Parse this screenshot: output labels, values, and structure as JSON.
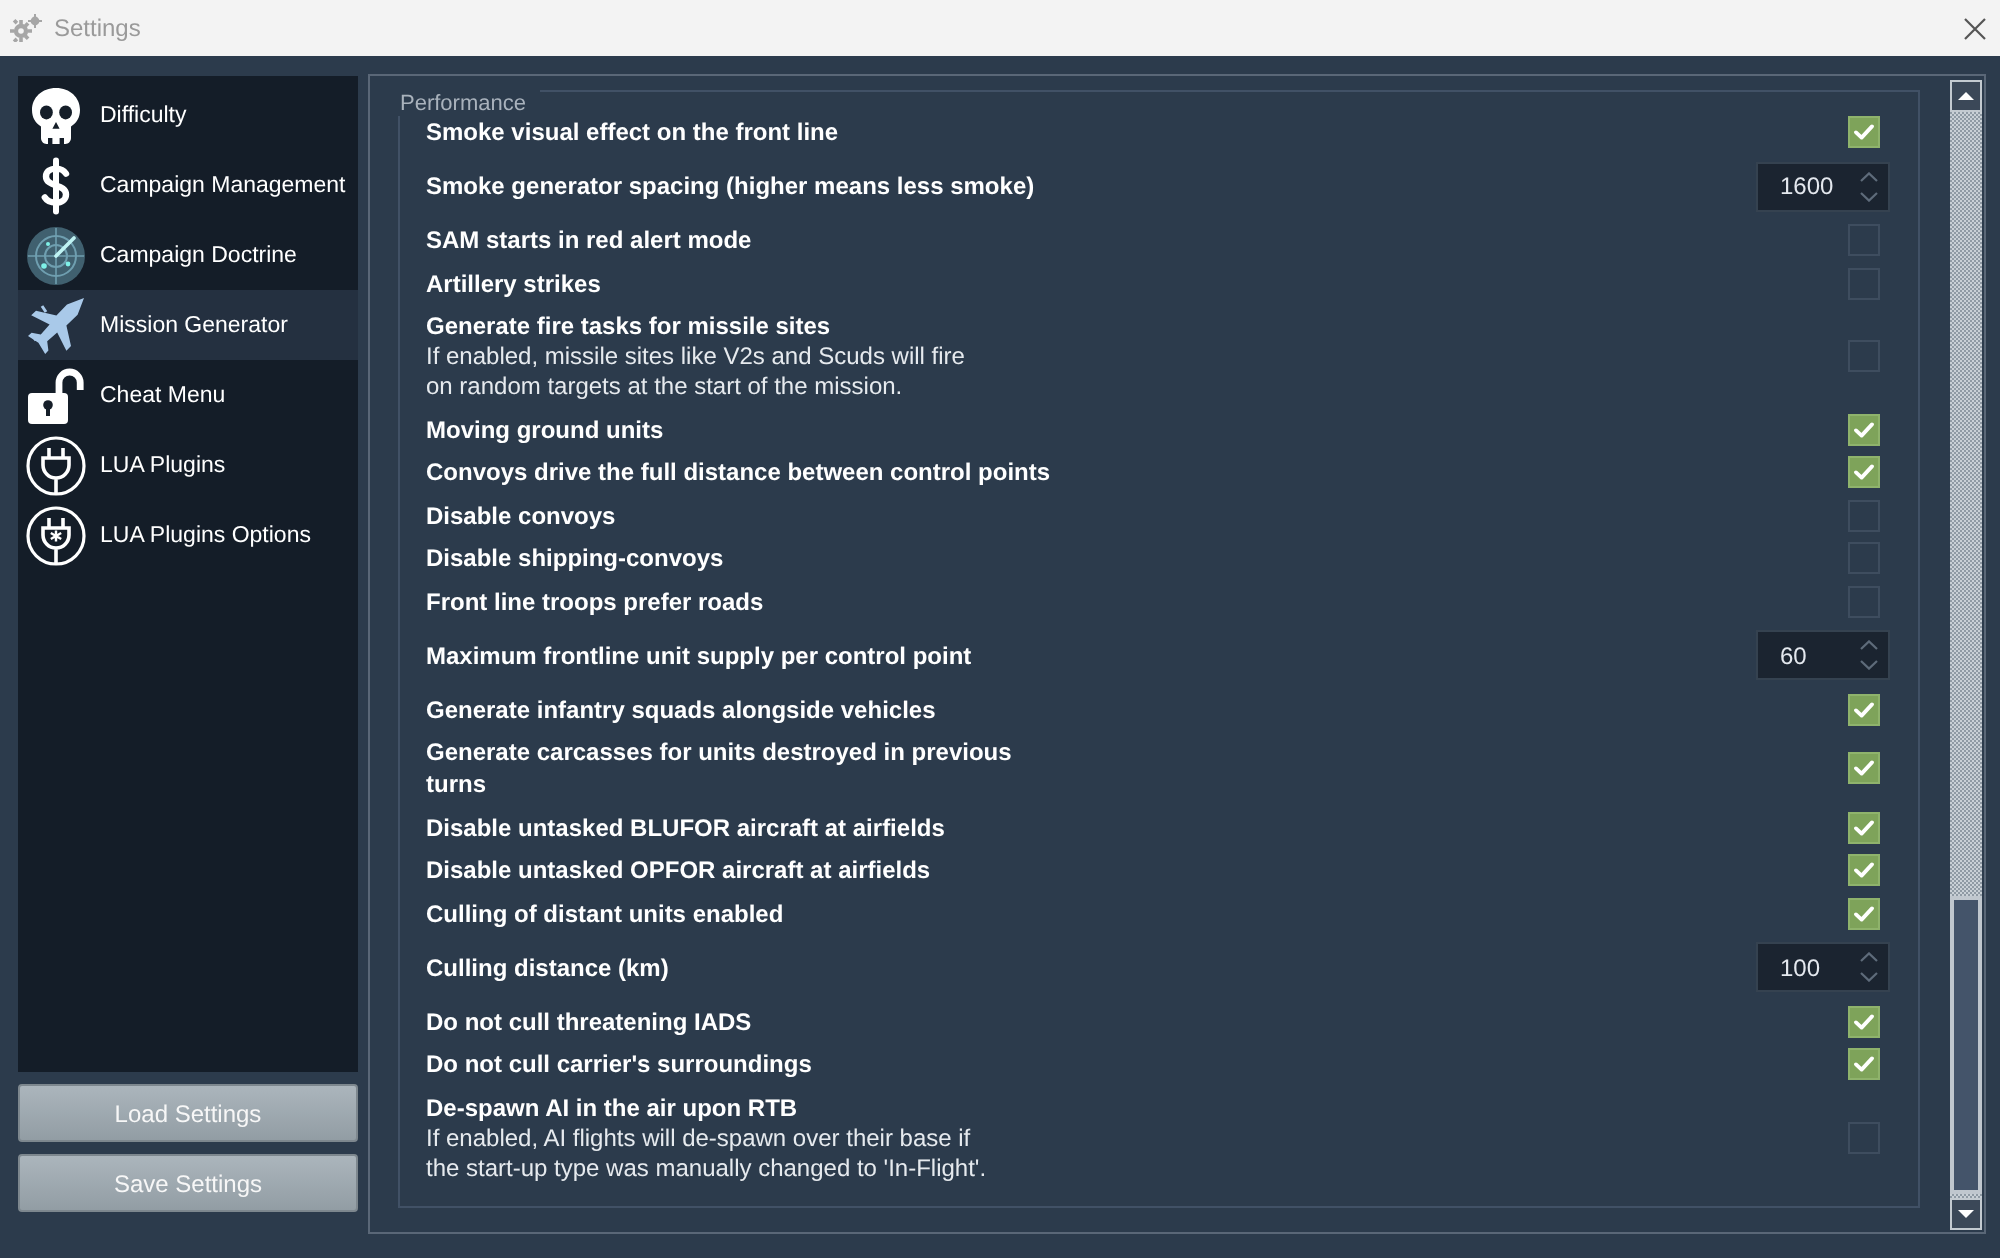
{
  "window": {
    "title": "Settings"
  },
  "sidebar": {
    "items": [
      {
        "label": "Difficulty",
        "selected": false
      },
      {
        "label": "Campaign Management",
        "selected": false
      },
      {
        "label": "Campaign Doctrine",
        "selected": false
      },
      {
        "label": "Mission Generator",
        "selected": true
      },
      {
        "label": "Cheat Menu",
        "selected": false
      },
      {
        "label": "LUA Plugins",
        "selected": false
      },
      {
        "label": "LUA Plugins Options",
        "selected": false
      }
    ]
  },
  "buttons": [
    "Load Settings",
    "Save Settings"
  ],
  "group": {
    "title": "Performance",
    "rows": [
      {
        "kind": "checkbox",
        "label": "Smoke visual effect on the front line",
        "checked": true
      },
      {
        "kind": "spinner",
        "label": "Smoke generator spacing (higher means less smoke)",
        "value": "1600"
      },
      {
        "kind": "checkbox",
        "label": "SAM starts in red alert mode",
        "checked": false
      },
      {
        "kind": "checkbox",
        "label": "Artillery strikes",
        "checked": false
      },
      {
        "kind": "checkbox",
        "label": "Generate fire tasks for missile sites",
        "description": "If enabled, missile sites like V2s and Scuds will fire\non random targets at the start of the mission.",
        "checked": false
      },
      {
        "kind": "checkbox",
        "label": "Moving ground units",
        "checked": true
      },
      {
        "kind": "checkbox",
        "label": "Convoys drive the full distance between control points",
        "checked": true
      },
      {
        "kind": "checkbox",
        "label": "Disable convoys",
        "checked": false
      },
      {
        "kind": "checkbox",
        "label": "Disable shipping-convoys",
        "checked": false
      },
      {
        "kind": "checkbox",
        "label": "Front line troops prefer roads",
        "checked": false
      },
      {
        "kind": "spinner",
        "label": "Maximum frontline unit supply per control point",
        "value": "60"
      },
      {
        "kind": "checkbox",
        "label": "Generate infantry squads alongside vehicles",
        "checked": true
      },
      {
        "kind": "checkbox",
        "label": "Generate carcasses for units destroyed in previous turns",
        "checked": true
      },
      {
        "kind": "checkbox",
        "label": "Disable untasked BLUFOR aircraft at airfields",
        "checked": true
      },
      {
        "kind": "checkbox",
        "label": "Disable untasked OPFOR aircraft at airfields",
        "checked": true
      },
      {
        "kind": "checkbox",
        "label": "Culling of distant units enabled",
        "checked": true
      },
      {
        "kind": "spinner",
        "label": "Culling distance (km)",
        "value": "100"
      },
      {
        "kind": "checkbox",
        "label": "Do not cull threatening IADS",
        "checked": true
      },
      {
        "kind": "checkbox",
        "label": "Do not cull carrier's surroundings",
        "checked": true
      },
      {
        "kind": "checkbox",
        "label": "De-spawn AI in the air upon RTB",
        "description": "If enabled, AI flights will de-spawn over their base if\nthe start-up type was manually changed to 'In-Flight'.",
        "checked": false
      }
    ]
  }
}
